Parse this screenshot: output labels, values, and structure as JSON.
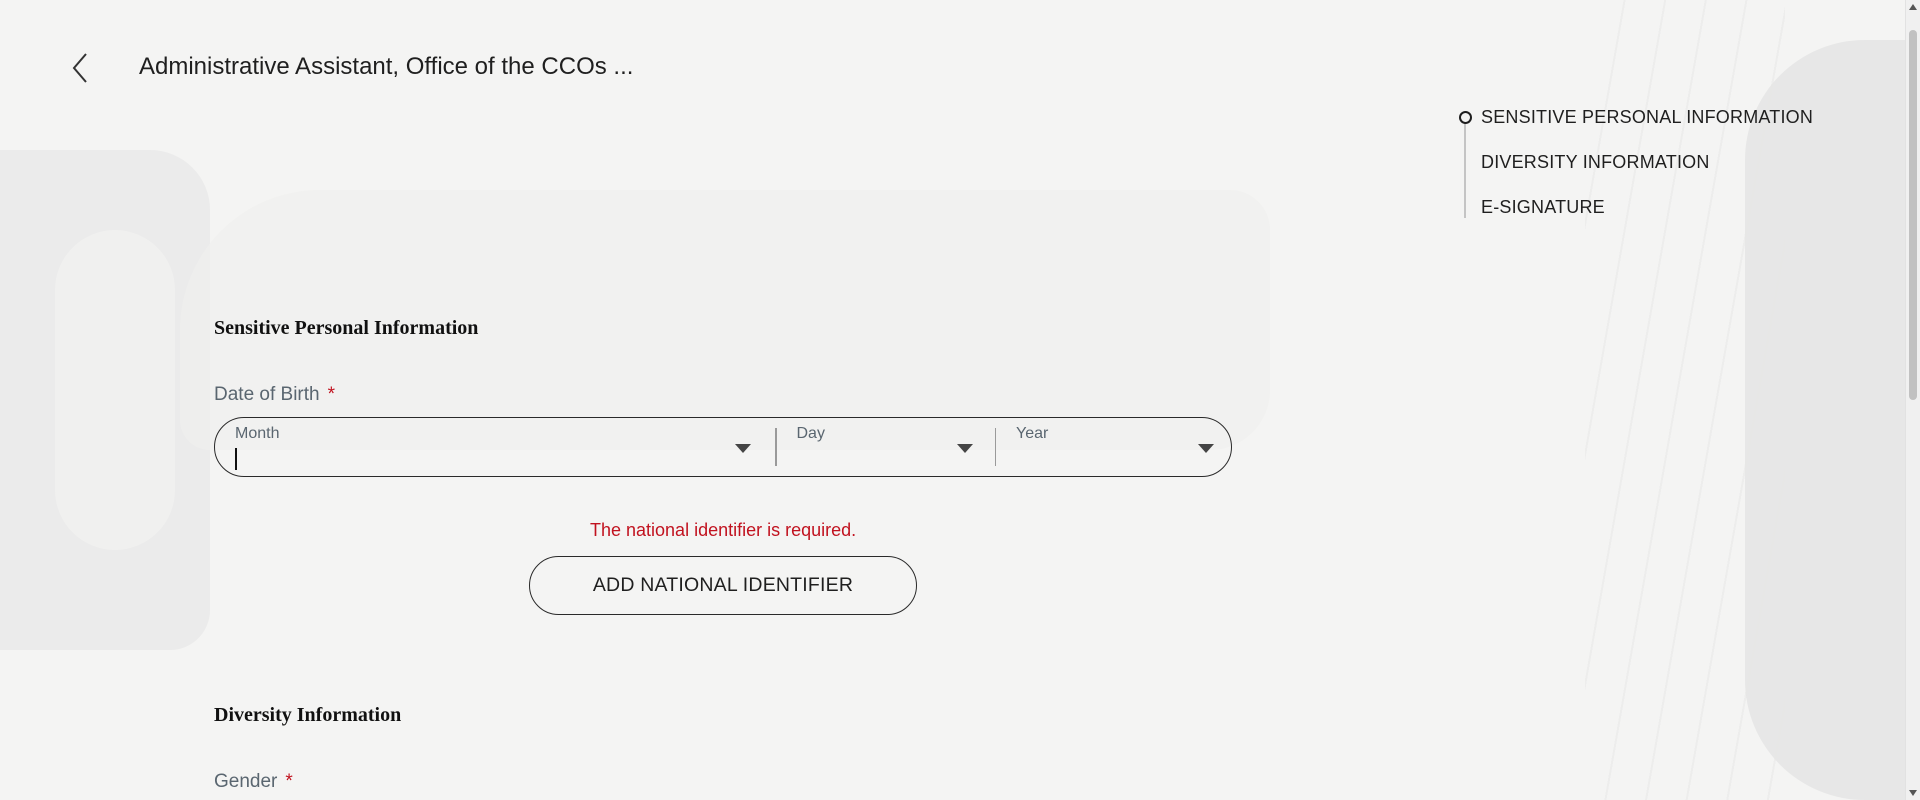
{
  "header": {
    "title": "Administrative Assistant, Office of the CCOs ..."
  },
  "stepper": {
    "items": [
      {
        "label": "SENSITIVE PERSONAL INFORMATION"
      },
      {
        "label": "DIVERSITY INFORMATION"
      },
      {
        "label": "E-SIGNATURE"
      }
    ]
  },
  "sensitive": {
    "title": "Sensitive Personal Information",
    "dob_label": "Date of Birth",
    "required_mark": "*",
    "month_label": "Month",
    "day_label": "Day",
    "year_label": "Year",
    "error": "The national identifier is required.",
    "add_button": "ADD NATIONAL IDENTIFIER"
  },
  "diversity": {
    "title": "Diversity Information",
    "gender_label": "Gender",
    "required_mark": "*"
  },
  "icons": {
    "back": "chevron-left-icon",
    "dropdown": "caret-down-icon"
  },
  "colors": {
    "error": "#c1121f",
    "background": "#f4f4f3"
  }
}
